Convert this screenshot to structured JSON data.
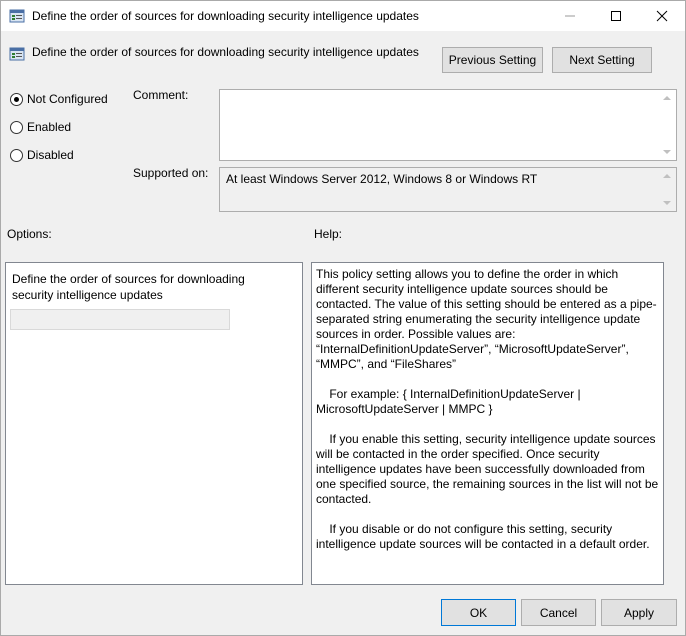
{
  "window": {
    "title": "Define the order of sources for downloading security intelligence updates",
    "icon": "policy-setting-icon"
  },
  "header": {
    "title": "Define the order of sources for downloading security intelligence updates",
    "previous_label": "Previous Setting",
    "next_label": "Next Setting"
  },
  "state": {
    "options": [
      {
        "label": "Not Configured",
        "checked": true
      },
      {
        "label": "Enabled",
        "checked": false
      },
      {
        "label": "Disabled",
        "checked": false
      }
    ]
  },
  "comment": {
    "label": "Comment:",
    "value": ""
  },
  "supported": {
    "label": "Supported on:",
    "value": "At least Windows Server 2012, Windows 8 or Windows RT"
  },
  "options_section": {
    "label": "Options:",
    "description": "Define the order of sources for downloading security intelligence updates",
    "input_value": ""
  },
  "help_section": {
    "label": "Help:",
    "paragraphs": [
      "This policy setting allows you to define the order in which different security intelligence update sources should be contacted. The value of this setting should be entered as a pipe-separated string enumerating the security intelligence update sources in order. Possible values are: “InternalDefinitionUpdateServer”, “MicrosoftUpdateServer”, “MMPC”, and “FileShares”",
      "    For example: { InternalDefinitionUpdateServer | MicrosoftUpdateServer | MMPC }",
      "    If you enable this setting, security intelligence update sources will be contacted in the order specified. Once security intelligence updates have been successfully downloaded from one specified source, the remaining sources in the list will not be contacted.",
      "    If you disable or do not configure this setting, security intelligence update sources will be contacted in a default order."
    ]
  },
  "footer": {
    "ok_label": "OK",
    "cancel_label": "Cancel",
    "apply_label": "Apply"
  },
  "colors": {
    "accent": "#0078d7",
    "background": "#f0f0f0",
    "button": "#e1e1e1"
  }
}
